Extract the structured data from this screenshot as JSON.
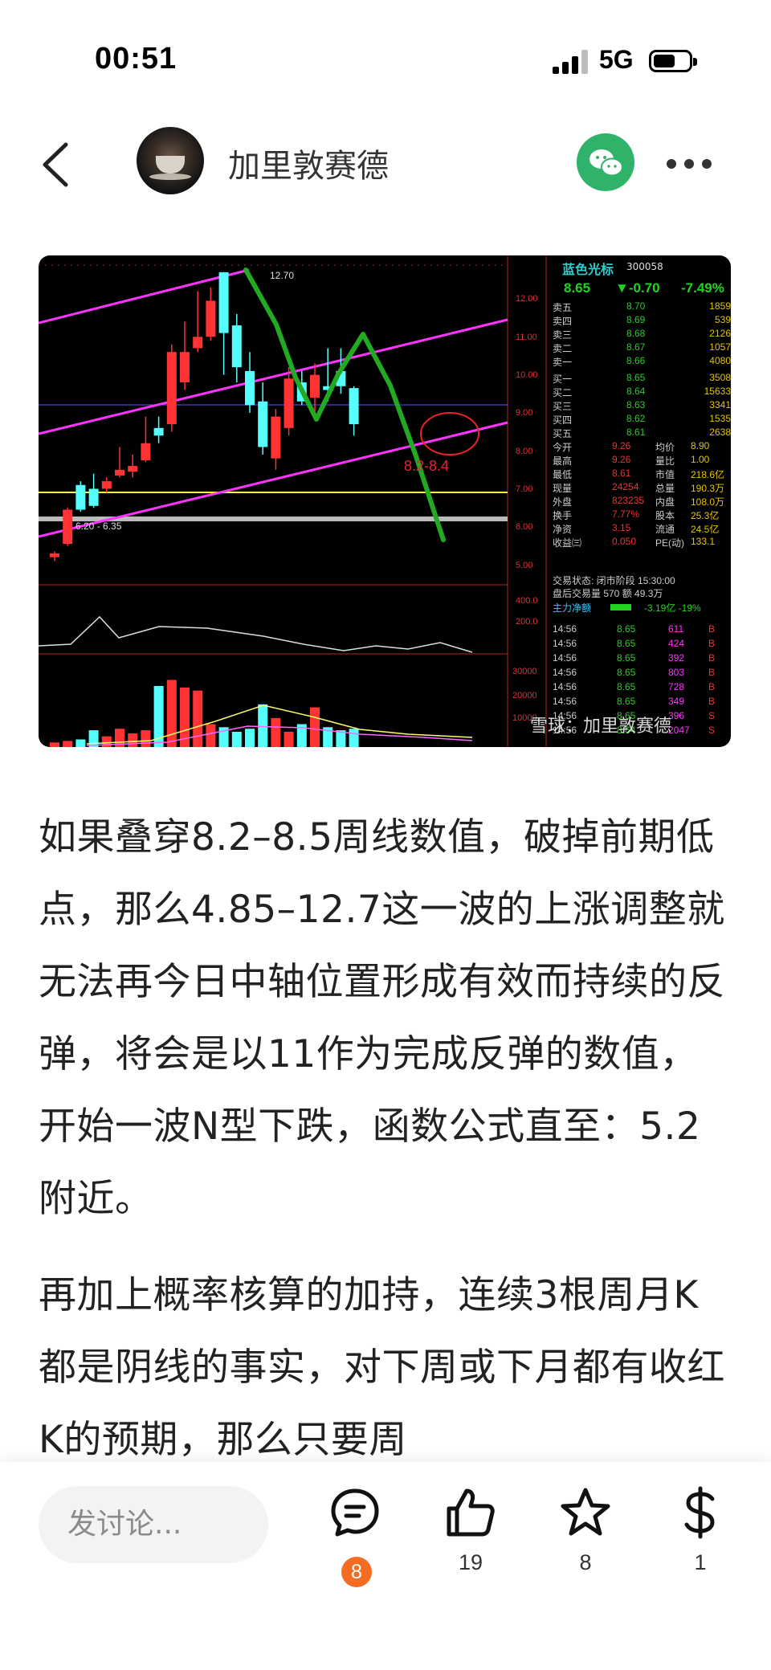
{
  "status_bar": {
    "time": "00:51",
    "network": "5G"
  },
  "header": {
    "author_name": "加里敦赛德"
  },
  "stock_screenshot": {
    "top_marker": "12.70",
    "range_marker": "6.20 - 6.35",
    "annotation": "8.2-8.4",
    "watermark": "雪球：加里敦赛德",
    "y_axis": [
      "12.00",
      "11.00",
      "10.00",
      "9.00",
      "8.00",
      "7.00",
      "6.00",
      "5.00"
    ],
    "indicator_axis": [
      "400.0",
      "200.0",
      "30000",
      "20000",
      "10000"
    ],
    "quote_panel": {
      "name": "蓝色光标",
      "code": "300058",
      "price": "8.65",
      "change": "▼-0.70",
      "change_pct": "-7.49%",
      "order_book": [
        {
          "label": "卖五",
          "price": "8.70",
          "volume": "1859"
        },
        {
          "label": "卖四",
          "price": "8.69",
          "volume": "539"
        },
        {
          "label": "卖三",
          "price": "8.68",
          "volume": "2126"
        },
        {
          "label": "卖二",
          "price": "8.67",
          "volume": "1057"
        },
        {
          "label": "卖一",
          "price": "8.66",
          "volume": "4080"
        },
        {
          "label": "买一",
          "price": "8.65",
          "volume": "3508"
        },
        {
          "label": "买二",
          "price": "8.64",
          "volume": "15633"
        },
        {
          "label": "买三",
          "price": "8.63",
          "volume": "3341"
        },
        {
          "label": "买四",
          "price": "8.62",
          "volume": "1535"
        },
        {
          "label": "买五",
          "price": "8.61",
          "volume": "2638"
        }
      ],
      "stats": [
        {
          "l1": "今开",
          "v1": "9.26",
          "l2": "均价",
          "v2": "8.90"
        },
        {
          "l1": "最高",
          "v1": "9.26",
          "l2": "量比",
          "v2": "1.00"
        },
        {
          "l1": "最低",
          "v1": "8.61",
          "l2": "市值",
          "v2": "218.6亿"
        },
        {
          "l1": "现量",
          "v1": "24254",
          "l2": "总量",
          "v2": "190.3万"
        },
        {
          "l1": "外盘",
          "v1": "823235",
          "l2": "内盘",
          "v2": "108.0万"
        },
        {
          "l1": "换手",
          "v1": "7.77%",
          "l2": "股本",
          "v2": "25.3亿"
        },
        {
          "l1": "净资",
          "v1": "3.15",
          "l2": "流通",
          "v2": "24.5亿"
        },
        {
          "l1": "收益㈢",
          "v1": "0.050",
          "l2": "PE(动)",
          "v2": "133.1"
        }
      ],
      "trade_status": "交易状态: 闭市阶段 15:30:00",
      "after_hours": "盘后交易量 570 额 49.3万",
      "main_flow": "主力净额",
      "main_flow_value": "-3.19亿 -19%",
      "ticks": [
        {
          "time": "14:56",
          "price": "8.65",
          "vol": "611",
          "side": "B"
        },
        {
          "time": "14:56",
          "price": "8.65",
          "vol": "424",
          "side": "B"
        },
        {
          "time": "14:56",
          "price": "8.65",
          "vol": "392",
          "side": "B"
        },
        {
          "time": "14:56",
          "price": "8.65",
          "vol": "803",
          "side": "B"
        },
        {
          "time": "14:56",
          "price": "8.65",
          "vol": "728",
          "side": "B"
        },
        {
          "time": "14:56",
          "price": "8.65",
          "vol": "349",
          "side": "B"
        },
        {
          "time": "14:56",
          "price": "8.65",
          "vol": "396",
          "side": "S"
        },
        {
          "time": "14:56",
          "price": "8.64",
          "vol": "2047",
          "side": "S"
        }
      ]
    }
  },
  "article": {
    "paragraphs": [
      "如果叠穿8.2–8.5周线数值，破掉前期低点，那么4.85–12.7这一波的上涨调整就无法再今日中轴位置形成有效而持续的反弹，将会是以11作为完成反弹的数值，开始一波N型下跌，函数公式直至：5.2附近。",
      "再加上概率核算的加持，连续3根周月K都是阴线的事实，对下周或下月都有收红K的预期，那么只要周"
    ]
  },
  "bottom_bar": {
    "comment_placeholder": "发讨论...",
    "comments_count": "8",
    "likes_count": "19",
    "favorites_count": "8",
    "rewards_count": "1"
  },
  "colors": {
    "wechat_green": "#2fb36a",
    "badge_orange": "#f36c21",
    "chart_up": "#ff3333",
    "chart_down": "#55ffff",
    "channel_magenta": "#ff33ff",
    "trend_green": "#22aa22"
  }
}
